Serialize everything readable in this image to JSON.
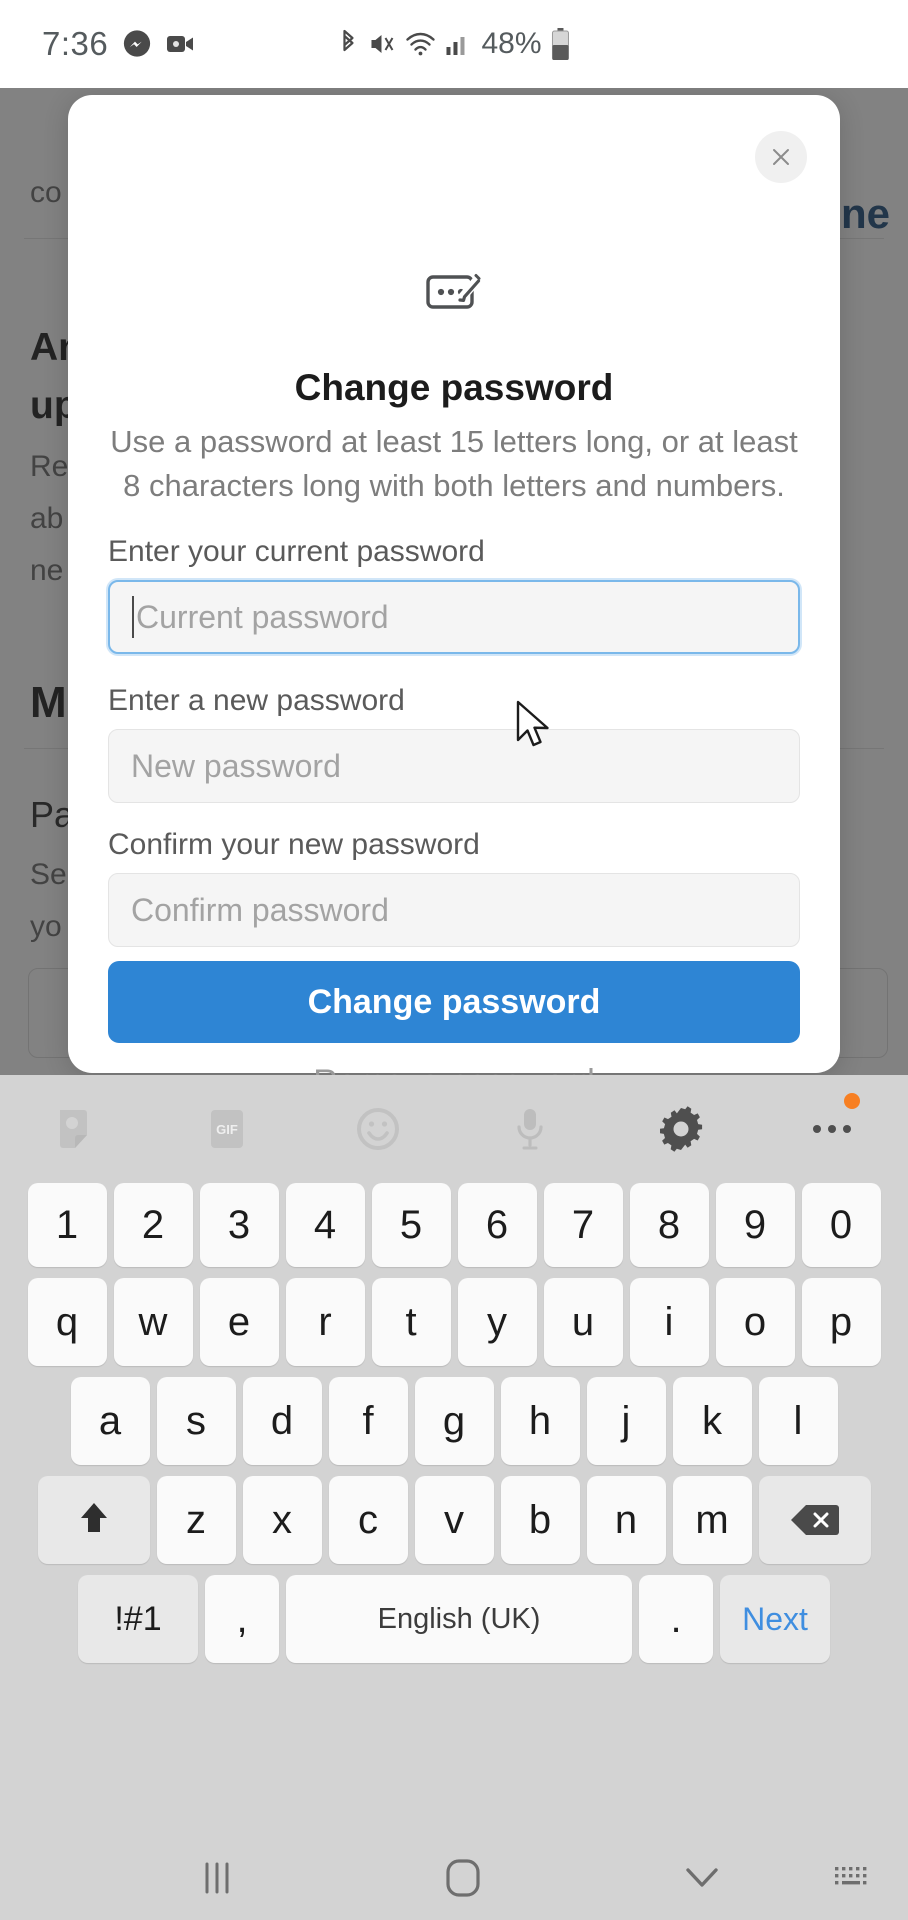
{
  "status_bar": {
    "time": "7:36",
    "battery_percent": "48%",
    "left_icons": [
      "messenger-icon",
      "video-camera-icon"
    ],
    "right_icons": [
      "bluetooth-icon",
      "mute-icon",
      "wifi-icon",
      "cellular-signal-icon",
      "battery-icon"
    ]
  },
  "background_page": {
    "fragment_1": "co",
    "fragment_2": "An",
    "fragment_3": "up",
    "fragment_4": "Re",
    "fragment_5": "ab",
    "fragment_6": "ne",
    "fragment_7": "M",
    "fragment_8": "Pa",
    "fragment_9": "Se",
    "fragment_10": "yo",
    "link_fragment": "ne"
  },
  "modal": {
    "icon": "password-edit-icon",
    "title": "Change password",
    "subtitle": "Use a password at least 15 letters long, or at least 8 characters long with both letters and numbers.",
    "close_label": "×",
    "fields": [
      {
        "name": "current-password",
        "label": "Enter your current password",
        "placeholder": "Current password",
        "value": "",
        "focused": true
      },
      {
        "name": "new-password",
        "label": "Enter a new password",
        "placeholder": "New password",
        "value": "",
        "focused": false
      },
      {
        "name": "confirm-password",
        "label": "Confirm your new password",
        "placeholder": "Confirm password",
        "value": "",
        "focused": false
      }
    ],
    "primary_button": "Change password",
    "secondary_link": "Remove password",
    "accent_color": "#2e85d4",
    "focus_border_color": "#7ab8ea"
  },
  "keyboard": {
    "toolbar_icons": [
      "sticker-icon",
      "gif-icon",
      "emoji-icon",
      "microphone-icon",
      "settings-gear-icon",
      "more-options-icon"
    ],
    "gif_label": "GIF",
    "badge_color": "#f77f22",
    "rows": {
      "numbers": [
        "1",
        "2",
        "3",
        "4",
        "5",
        "6",
        "7",
        "8",
        "9",
        "0"
      ],
      "top": [
        "q",
        "w",
        "e",
        "r",
        "t",
        "y",
        "u",
        "i",
        "o",
        "p"
      ],
      "home": [
        "a",
        "s",
        "d",
        "f",
        "g",
        "h",
        "j",
        "k",
        "l"
      ],
      "bottom": [
        "z",
        "x",
        "c",
        "v",
        "b",
        "n",
        "m"
      ]
    },
    "shift_key": "shift-icon",
    "backspace_key": "backspace-icon",
    "symbols_key": "!#1",
    "comma_key": ",",
    "space_key": "English (UK)",
    "period_key": ".",
    "next_key": "Next",
    "next_key_color": "#3f8ee0"
  },
  "nav_bar": {
    "recent_apps": "recent-apps-icon",
    "home": "home-icon",
    "back": "back-chevron-icon",
    "hide_keyboard": "hide-keyboard-icon"
  }
}
